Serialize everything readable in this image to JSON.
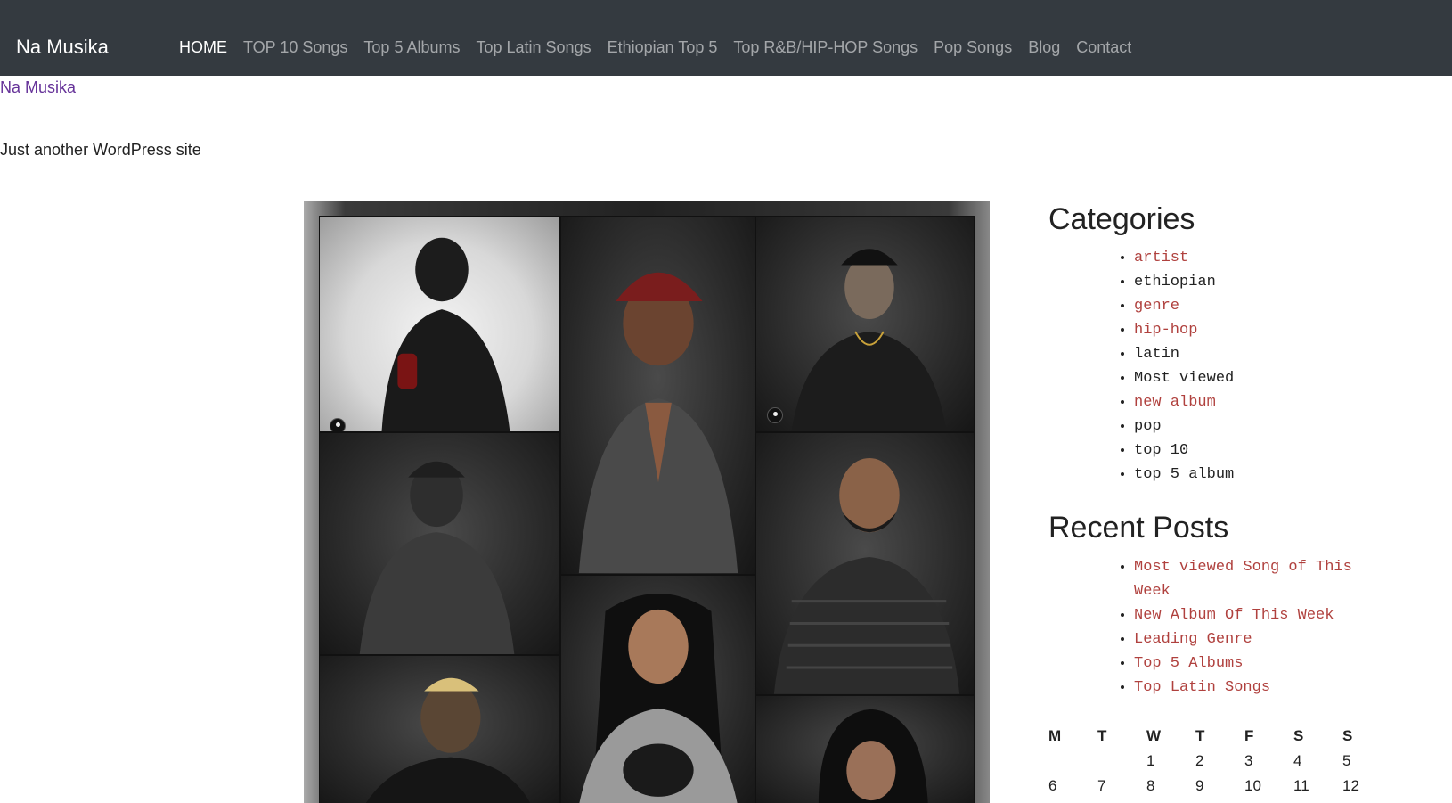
{
  "nav": {
    "brand": "Na Musika",
    "links": [
      {
        "label": "HOME",
        "active": true
      },
      {
        "label": "TOP 10 Songs",
        "active": false
      },
      {
        "label": "Top 5 Albums",
        "active": false
      },
      {
        "label": "Top Latin Songs",
        "active": false
      },
      {
        "label": "Ethiopian Top 5",
        "active": false
      },
      {
        "label": "Top R&B/HIP-HOP Songs",
        "active": false
      },
      {
        "label": "Pop Songs",
        "active": false
      },
      {
        "label": "Blog",
        "active": false
      },
      {
        "label": "Contact",
        "active": false
      }
    ]
  },
  "site": {
    "title": "Na Musika",
    "tagline": "Just another WordPress site"
  },
  "categories": {
    "title": "Categories",
    "items": [
      {
        "label": "artist",
        "visited": false
      },
      {
        "label": "ethiopian",
        "visited": true
      },
      {
        "label": "genre",
        "visited": false
      },
      {
        "label": "hip-hop",
        "visited": false
      },
      {
        "label": "latin",
        "visited": true
      },
      {
        "label": "Most viewed",
        "visited": true
      },
      {
        "label": "new album",
        "visited": false
      },
      {
        "label": "pop",
        "visited": true
      },
      {
        "label": "top 10",
        "visited": true
      },
      {
        "label": "top 5 album",
        "visited": true
      }
    ]
  },
  "recent_posts": {
    "title": "Recent Posts",
    "items": [
      "Most viewed Song of This Week",
      "New Album Of This Week",
      "Leading Genre",
      "Top 5 Albums",
      "Top Latin Songs"
    ]
  },
  "calendar": {
    "headers": [
      "M",
      "T",
      "W",
      "T",
      "F",
      "S",
      "S"
    ],
    "rows": [
      [
        "",
        "",
        "1",
        "2",
        "3",
        "4",
        "5"
      ],
      [
        "6",
        "7",
        "8",
        "9",
        "10",
        "11",
        "12"
      ]
    ]
  },
  "colors": {
    "navbar_bg": "#343a40",
    "link_red": "#b0413e",
    "site_title": "#663399"
  }
}
